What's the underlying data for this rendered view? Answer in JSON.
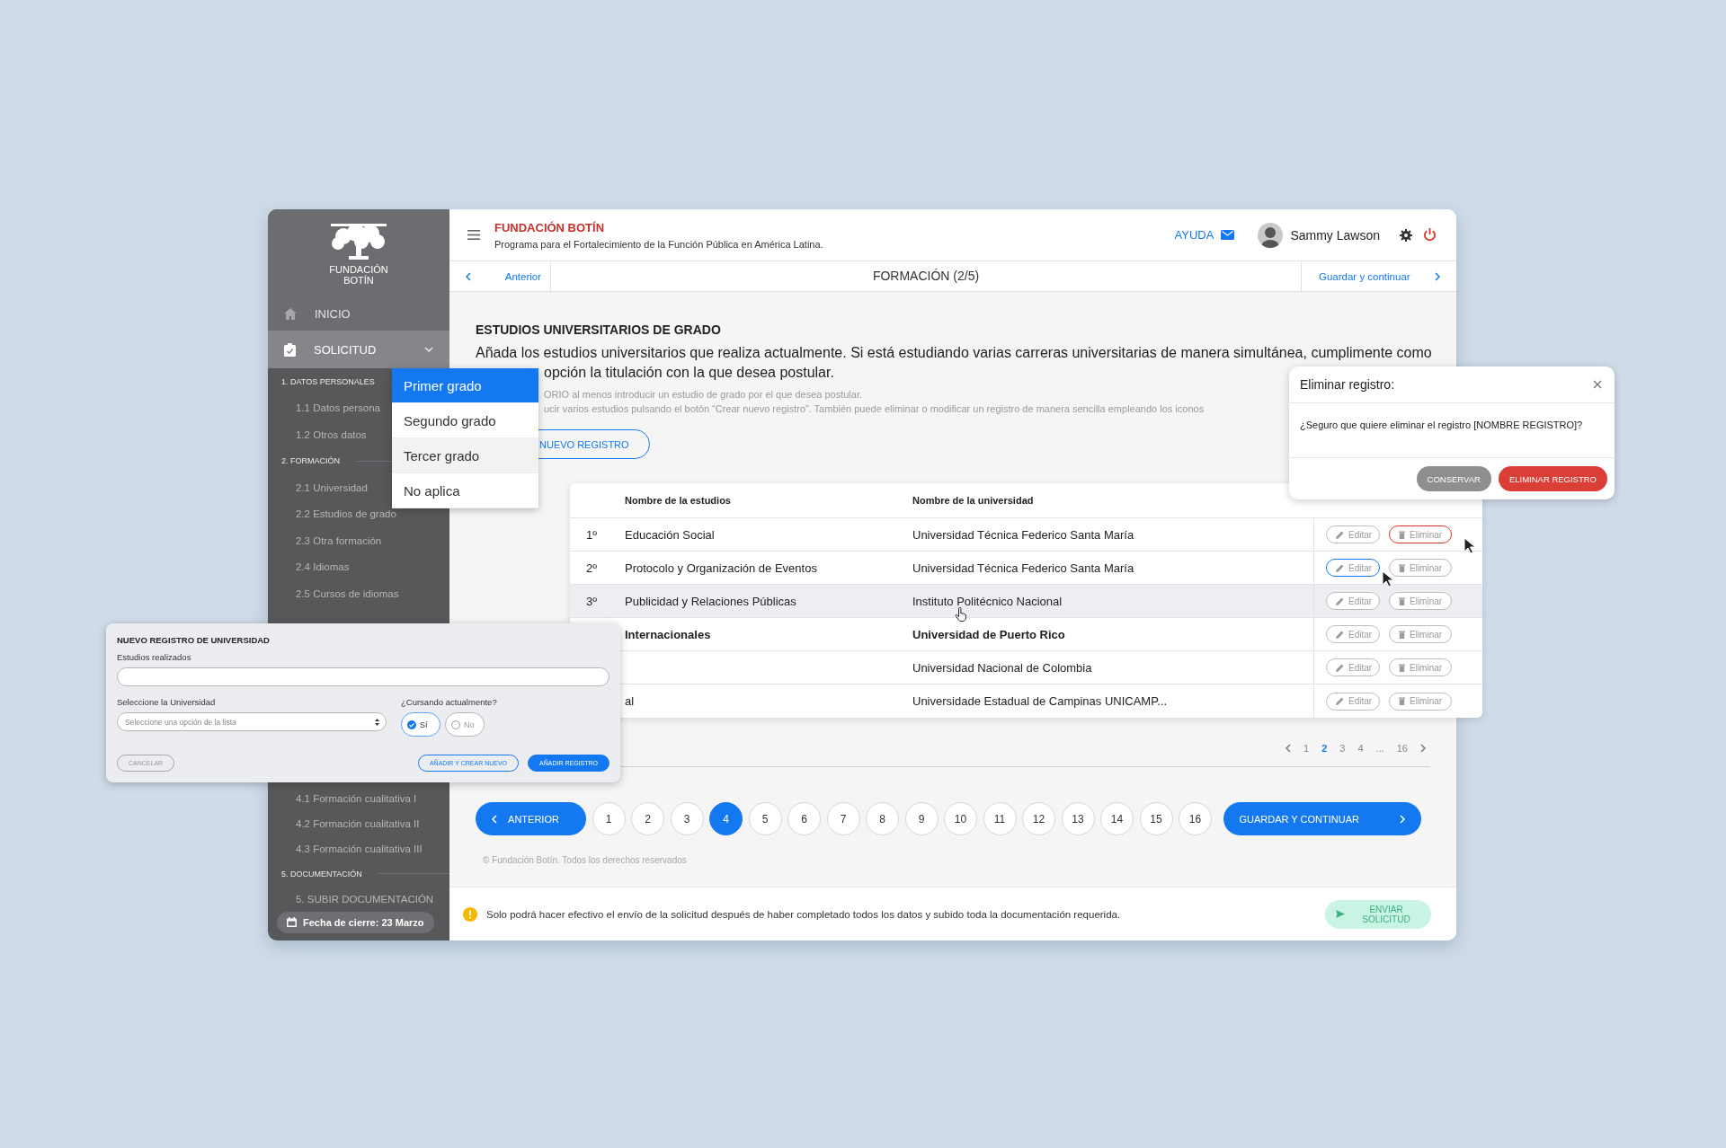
{
  "sidebar": {
    "logo_lines": [
      "FUNDACIÓN",
      "BOTÍN"
    ],
    "menu": [
      {
        "kind": "link",
        "label": "INICIO",
        "selected": false
      },
      {
        "kind": "group",
        "label": "SOLICITUD",
        "selected": true,
        "expanded": true
      }
    ],
    "nav_groups": [
      [
        {
          "kind": "section",
          "label": "1. DATOS PERSONALES"
        },
        {
          "kind": "item",
          "label": "1.1 Datos persona"
        },
        {
          "kind": "item",
          "label": "1.2 Otros datos"
        },
        {
          "kind": "section",
          "label": "2. FORMACIÓN"
        },
        {
          "kind": "item",
          "label": "2.1 Universidad"
        },
        {
          "kind": "item",
          "label": "2.2 Estudios de grado"
        },
        {
          "kind": "item",
          "label": "2.3 Otra formación"
        },
        {
          "kind": "item",
          "label": "2.4 Idiomas"
        },
        {
          "kind": "item",
          "label": "2.5 Cursos de idiomas"
        }
      ],
      [
        {
          "kind": "item",
          "label": "4.1 Formación cualitativa I"
        },
        {
          "kind": "item",
          "label": "4.2 Formación cualitativa II"
        },
        {
          "kind": "item",
          "label": "4.3 Formación cualitativa III"
        },
        {
          "kind": "section",
          "label": "5. DOCUMENTACIÓN"
        },
        {
          "kind": "item",
          "label": "5. SUBIR DOCUMENTACIÓN"
        }
      ]
    ],
    "deadline": "Fecha de cierre: 23 Marzo"
  },
  "header": {
    "title": "FUNDACIÓN BOTÍN",
    "subtitle": "Programa para el Fortalecimiento de la Función Pública en América Latina.",
    "help": "AYUDA",
    "user": "Sammy Lawson"
  },
  "step_nav": {
    "previous": "Anterior",
    "title": "FORMACIÓN (2/5)",
    "next": "Guardar y continuar"
  },
  "content": {
    "heading": "ESTUDIOS UNIVERSITARIOS DE GRADO",
    "intro_lines": [
      "Añada los estudios universitarios que realiza actualmente. Si está estudiando varias carreras universitarias de manera simultánea, cumplimente como",
      "opción la titulación con la que desea postular."
    ],
    "notes": [
      "ORIO al menos introducir un estudio de grado por el que desea postular.",
      "ucir varios estudios pulsando el botón “Crear nuevo registro”. También puede eliminar o modificar un registro de manera sencilla empleando los iconos"
    ],
    "new_button": "NUEVO REGISTRO"
  },
  "table": {
    "columns": [
      "Nombre de la estudios",
      "Nombre de la universidad"
    ],
    "rows": [
      {
        "number": "1º",
        "study": "Educación Social",
        "university": "Universidad Técnica Federico Santa María",
        "hovered": false,
        "emphasized": false,
        "edit": "Editar",
        "delete": "Eliminar",
        "edit_focused": false,
        "delete_focused": true
      },
      {
        "number": "2º",
        "study": "Protocolo y Organización de Eventos",
        "university": "Universidad Técnica Federico Santa María",
        "hovered": false,
        "emphasized": false,
        "edit": "Editar",
        "delete": "Eliminar",
        "edit_focused": true,
        "delete_focused": false
      },
      {
        "number": "3º",
        "study": "Publicidad y Relaciones Públicas",
        "university": "Instituto Politécnico Nacional",
        "hovered": true,
        "emphasized": false,
        "edit": "Editar",
        "delete": "Eliminar",
        "edit_focused": false,
        "delete_focused": false
      },
      {
        "study": "Internacionales",
        "university": "Universidad de Puerto Rico",
        "hovered": false,
        "emphasized": true,
        "edit": "Editar",
        "delete": "Eliminar",
        "edit_focused": false,
        "delete_focused": false
      },
      {
        "university": "Universidad Nacional de Colombia",
        "hovered": false,
        "emphasized": false,
        "edit": "Editar",
        "delete": "Eliminar",
        "edit_focused": false,
        "delete_focused": false
      },
      {
        "study": "al",
        "university": "Universidade Estadual de Campinas UNICAMP...",
        "hovered": false,
        "emphasized": false,
        "edit": "Editar",
        "delete": "Eliminar",
        "edit_focused": false,
        "delete_focused": false
      }
    ]
  },
  "table_pager": [
    {
      "label": "1",
      "selected": false
    },
    {
      "label": "2",
      "selected": true
    },
    {
      "label": "3",
      "selected": false
    },
    {
      "label": "4",
      "selected": false
    },
    {
      "label": "...",
      "selected": false
    },
    {
      "label": "16",
      "selected": false
    }
  ],
  "pager": {
    "previous": "ANTERIOR",
    "next": "GUARDAR Y CONTINUAR",
    "pages": [
      {
        "label": "1",
        "selected": false
      },
      {
        "label": "2",
        "selected": false
      },
      {
        "label": "3",
        "selected": false
      },
      {
        "label": "4",
        "selected": true
      },
      {
        "label": "5",
        "selected": false
      },
      {
        "label": "6",
        "selected": false
      },
      {
        "label": "7",
        "selected": false
      },
      {
        "label": "8",
        "selected": false
      },
      {
        "label": "9",
        "selected": false
      },
      {
        "label": "10",
        "selected": false
      },
      {
        "label": "11",
        "selected": false
      },
      {
        "label": "12",
        "selected": false
      },
      {
        "label": "13",
        "selected": false
      },
      {
        "label": "14",
        "selected": false
      },
      {
        "label": "15",
        "selected": false
      },
      {
        "label": "16",
        "selected": false
      }
    ]
  },
  "copyright": "© Fundación Botín. Todos los derechos reservados",
  "bottom_bar": {
    "message": "Solo podrá hacer efectivo el envío de la solicitud después de haber completado todos los datos y subido toda la documentación requerida.",
    "send": {
      "label": "ENVIAR SOLICITUD",
      "disabled": true
    }
  },
  "dropdown": {
    "options": [
      {
        "label": "Primer grado",
        "selected": true,
        "hovered": false
      },
      {
        "label": "Segundo grado",
        "selected": false,
        "hovered": false
      },
      {
        "label": "Tercer grado",
        "selected": false,
        "hovered": true
      },
      {
        "label": "No aplica",
        "selected": false,
        "hovered": false
      }
    ]
  },
  "delete_dialog": {
    "title": "Eliminar registro:",
    "message": "¿Seguro que quiere eliminar el registro [NOMBRE REGISTRO]?",
    "buttons": [
      {
        "kind": "secondary",
        "label": "CONSERVAR"
      },
      {
        "kind": "danger",
        "label": "ELIMINAR REGISTRO"
      }
    ]
  },
  "record_modal": {
    "title": "NUEVO REGISTRO DE UNIVERSIDAD",
    "studies_label": "Estudios realizados",
    "university_label": "Seleccione la Universidad",
    "university_placeholder": "Seleccione una opción de la lista",
    "current_label": "¿Cursando actualmente?",
    "current_options": [
      {
        "label": "Sí",
        "selected": true
      },
      {
        "label": "No",
        "selected": false
      }
    ],
    "cancel": "CANCELAR",
    "add_and_new": "AÑADIR Y CREAR NUEVO",
    "add": "AÑADIR REGISTRO"
  }
}
